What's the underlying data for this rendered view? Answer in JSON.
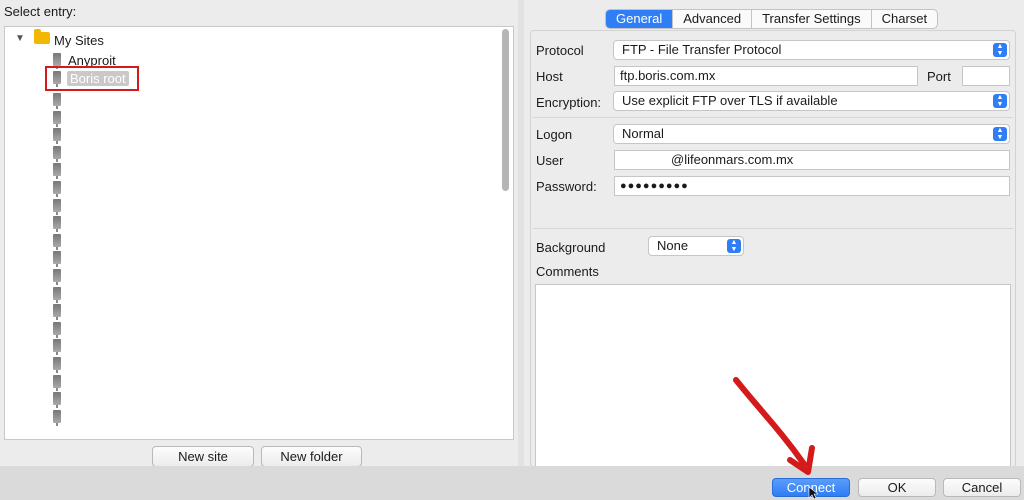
{
  "left_pane": {
    "select_entry_label": "Select entry:",
    "tree": {
      "root_label": "My Sites",
      "sites": [
        {
          "label": "Anyproit"
        },
        {
          "label": "Boris root"
        }
      ],
      "empty_icon_count_note": ""
    },
    "buttons": {
      "new_site": "New site",
      "new_folder": "New folder"
    }
  },
  "tabs": [
    {
      "label": "General",
      "active": true
    },
    {
      "label": "Advanced",
      "active": false
    },
    {
      "label": "Transfer Settings",
      "active": false
    },
    {
      "label": "Charset",
      "active": false
    }
  ],
  "general": {
    "protocol_label": "Protocol",
    "protocol_value": "FTP - File Transfer Protocol",
    "host_label": "Host",
    "host_value": "ftp.boris.com.mx",
    "port_label": "Port",
    "port_value": "",
    "encryption_label": "Encryption:",
    "encryption_value": "Use explicit FTP over TLS if available",
    "logon_label": "Logon",
    "logon_value": "Normal",
    "user_label": "User",
    "user_value": "@lifeonmars.com.mx",
    "password_label": "Password:",
    "password_value": "●●●●●●●●●",
    "background_label": "Background",
    "background_value": "None",
    "comments_label": "Comments"
  },
  "footer": {
    "connect": "Connect",
    "ok": "OK",
    "cancel": "Cancel"
  },
  "colors": {
    "accent": "#2f7ef5",
    "annotation_red": "#d41b1b"
  }
}
